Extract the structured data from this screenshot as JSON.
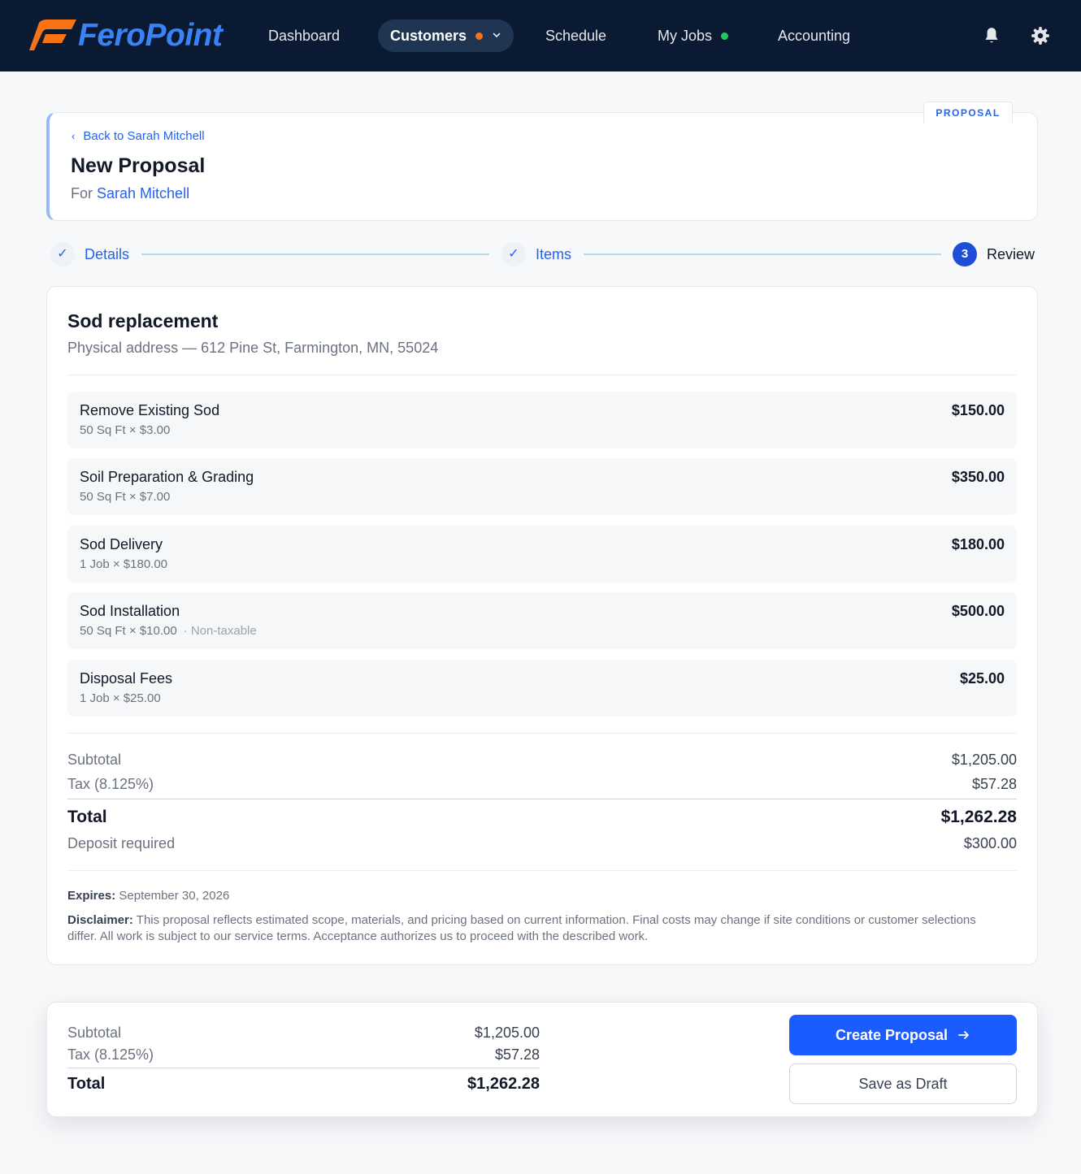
{
  "brand": {
    "name": "FeroPoint",
    "logo_colors": [
      "#f97316",
      "#3b82f6"
    ]
  },
  "nav": {
    "items": [
      {
        "label": "Dashboard"
      },
      {
        "label": "Customers",
        "active": true,
        "dot_color": "#f97316"
      },
      {
        "label": "Schedule"
      },
      {
        "label": "My Jobs",
        "dot_color": "#22c55e"
      },
      {
        "label": "Accounting"
      }
    ],
    "icons": [
      "bell-icon",
      "gear-icon"
    ]
  },
  "header": {
    "tag": "PROPOSAL",
    "back_label": "Back to Sarah Mitchell",
    "title": "New Proposal",
    "for_prefix": "For",
    "customer_name": "Sarah Mitchell"
  },
  "stepper": {
    "steps": [
      {
        "label": "Details",
        "state": "complete"
      },
      {
        "label": "Items",
        "state": "complete"
      },
      {
        "number": "3",
        "label": "Review",
        "state": "current"
      }
    ]
  },
  "review": {
    "job_title": "Sod replacement",
    "address": "Physical address — 612 Pine St, Farmington, MN, 55024",
    "line_items": [
      {
        "name": "Remove Existing Sod",
        "detail": "50 Sq Ft × $3.00",
        "note": "",
        "amount": "$150.00"
      },
      {
        "name": "Soil Preparation & Grading",
        "detail": "50 Sq Ft × $7.00",
        "note": "",
        "amount": "$350.00"
      },
      {
        "name": "Sod Delivery",
        "detail": "1 Job × $180.00",
        "note": "",
        "amount": "$180.00"
      },
      {
        "name": "Sod Installation",
        "detail": "50 Sq Ft × $10.00",
        "note": "· Non-taxable",
        "amount": "$500.00"
      },
      {
        "name": "Disposal Fees",
        "detail": "1 Job × $25.00",
        "note": "",
        "amount": "$25.00"
      }
    ],
    "subtotal_label": "Subtotal",
    "subtotal": "$1,205.00",
    "tax_label": "Tax (8.125%)",
    "tax": "$57.28",
    "total_label": "Total",
    "total": "$1,262.28",
    "deposit_label": "Deposit required",
    "deposit": "$300.00",
    "expires_label": "Expires:",
    "expires": "September 30, 2026",
    "disclaimer_label": "Disclaimer:",
    "disclaimer": "This proposal reflects estimated scope, materials, and pricing based on current information. Final costs may change if site conditions or customer selections differ. All work is subject to our service terms. Acceptance authorizes us to proceed with the described work."
  },
  "footer": {
    "subtotal_label": "Subtotal",
    "subtotal": "$1,205.00",
    "tax_label": "Tax (8.125%)",
    "tax": "$57.28",
    "total_label": "Total",
    "total": "$1,262.28",
    "create_label": "Create Proposal",
    "draft_label": "Save as Draft"
  },
  "colors": {
    "nav_bg": "#0b1a33",
    "primary": "#1a5cff",
    "link": "#2563eb"
  }
}
